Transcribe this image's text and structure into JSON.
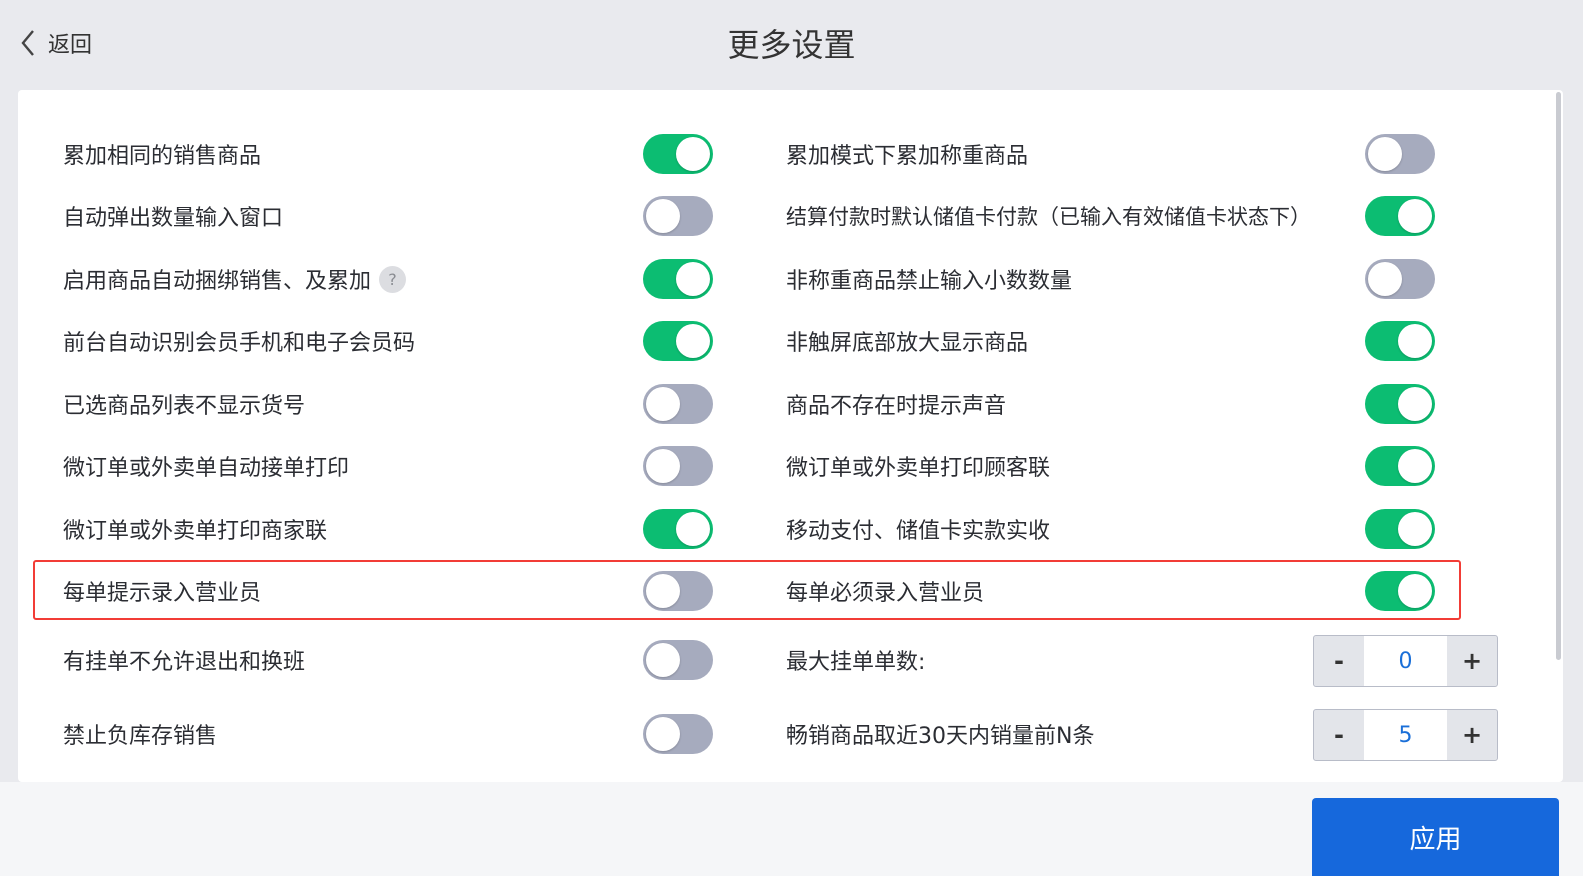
{
  "header": {
    "back_label": "返回",
    "title": "更多设置"
  },
  "settings_left": [
    {
      "label": "累加相同的销售商品",
      "on": true
    },
    {
      "label": "自动弹出数量输入窗口",
      "on": false
    },
    {
      "label": "启用商品自动捆绑销售、及累加",
      "on": true,
      "help": "?"
    },
    {
      "label": "前台自动识别会员手机和电子会员码",
      "on": true
    },
    {
      "label": "已选商品列表不显示货号",
      "on": false
    },
    {
      "label": "微订单或外卖单自动接单打印",
      "on": false
    },
    {
      "label": "微订单或外卖单打印商家联",
      "on": true
    },
    {
      "label": "每单提示录入营业员",
      "on": false
    },
    {
      "label": "有挂单不允许退出和换班",
      "on": false
    },
    {
      "label": "禁止负库存销售",
      "on": false
    }
  ],
  "settings_right": [
    {
      "label": "累加模式下累加称重商品",
      "on": false
    },
    {
      "label": "结算付款时默认储值卡付款（已输入有效储值卡状态下）",
      "on": true
    },
    {
      "label": "非称重商品禁止输入小数数量",
      "on": false
    },
    {
      "label": "非触屏底部放大显示商品",
      "on": true
    },
    {
      "label": "商品不存在时提示声音",
      "on": true
    },
    {
      "label": "微订单或外卖单打印顾客联",
      "on": true
    },
    {
      "label": "移动支付、储值卡实款实收",
      "on": true
    },
    {
      "label": "每单必须录入营业员",
      "on": true
    }
  ],
  "steppers": [
    {
      "label": "最大挂单单数:",
      "value": "0",
      "minus": "-",
      "plus": "+"
    },
    {
      "label": "畅销商品取近30天内销量前N条",
      "value": "5",
      "minus": "-",
      "plus": "+"
    }
  ],
  "footer": {
    "apply_label": "应用"
  },
  "colors": {
    "toggle_on": "#0cbd72",
    "toggle_off": "#a6abbe",
    "highlight": "#f23c36",
    "primary": "#1668dc"
  }
}
